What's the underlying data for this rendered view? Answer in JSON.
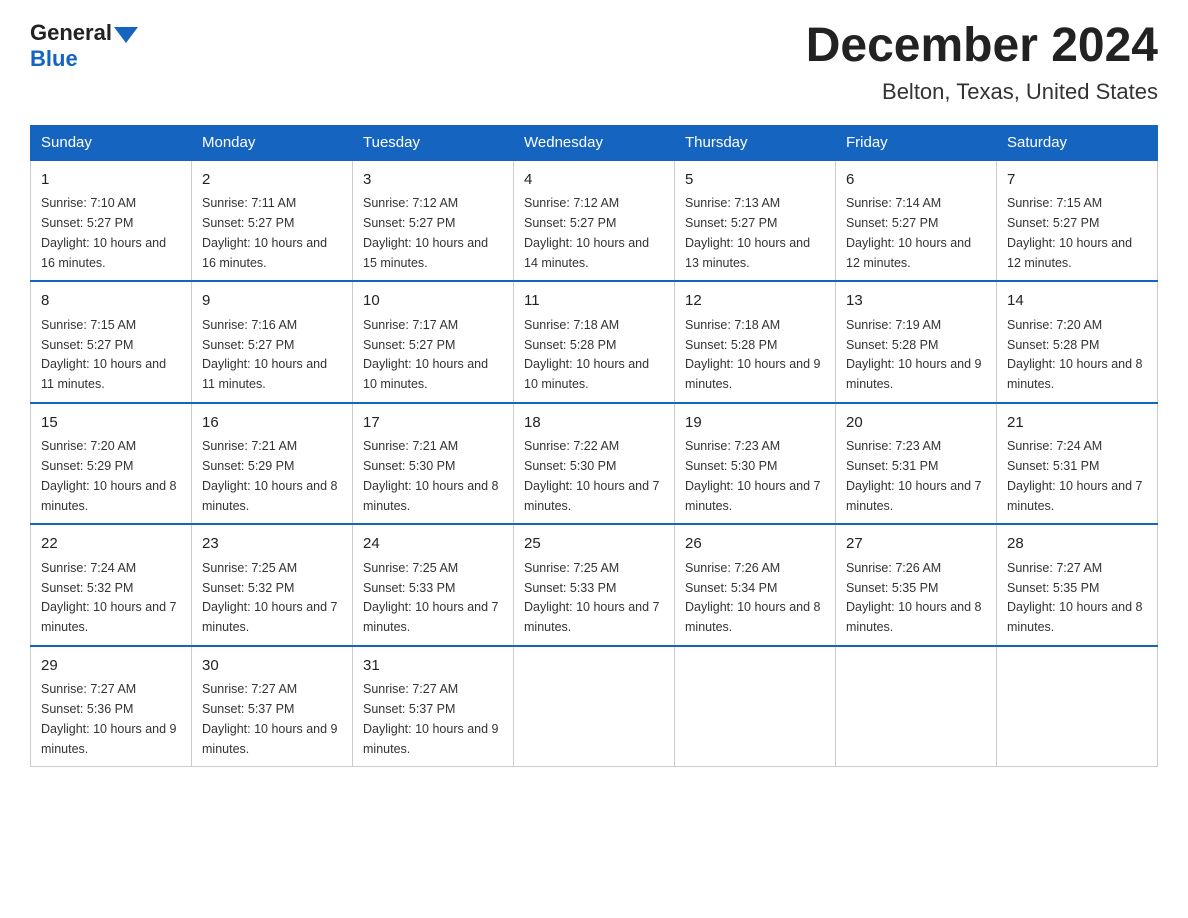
{
  "logo": {
    "general": "General",
    "triangle": "▶",
    "blue": "Blue"
  },
  "title": "December 2024",
  "subtitle": "Belton, Texas, United States",
  "days_of_week": [
    "Sunday",
    "Monday",
    "Tuesday",
    "Wednesday",
    "Thursday",
    "Friday",
    "Saturday"
  ],
  "weeks": [
    [
      {
        "day": "1",
        "sunrise": "7:10 AM",
        "sunset": "5:27 PM",
        "daylight": "10 hours and 16 minutes."
      },
      {
        "day": "2",
        "sunrise": "7:11 AM",
        "sunset": "5:27 PM",
        "daylight": "10 hours and 16 minutes."
      },
      {
        "day": "3",
        "sunrise": "7:12 AM",
        "sunset": "5:27 PM",
        "daylight": "10 hours and 15 minutes."
      },
      {
        "day": "4",
        "sunrise": "7:12 AM",
        "sunset": "5:27 PM",
        "daylight": "10 hours and 14 minutes."
      },
      {
        "day": "5",
        "sunrise": "7:13 AM",
        "sunset": "5:27 PM",
        "daylight": "10 hours and 13 minutes."
      },
      {
        "day": "6",
        "sunrise": "7:14 AM",
        "sunset": "5:27 PM",
        "daylight": "10 hours and 12 minutes."
      },
      {
        "day": "7",
        "sunrise": "7:15 AM",
        "sunset": "5:27 PM",
        "daylight": "10 hours and 12 minutes."
      }
    ],
    [
      {
        "day": "8",
        "sunrise": "7:15 AM",
        "sunset": "5:27 PM",
        "daylight": "10 hours and 11 minutes."
      },
      {
        "day": "9",
        "sunrise": "7:16 AM",
        "sunset": "5:27 PM",
        "daylight": "10 hours and 11 minutes."
      },
      {
        "day": "10",
        "sunrise": "7:17 AM",
        "sunset": "5:27 PM",
        "daylight": "10 hours and 10 minutes."
      },
      {
        "day": "11",
        "sunrise": "7:18 AM",
        "sunset": "5:28 PM",
        "daylight": "10 hours and 10 minutes."
      },
      {
        "day": "12",
        "sunrise": "7:18 AM",
        "sunset": "5:28 PM",
        "daylight": "10 hours and 9 minutes."
      },
      {
        "day": "13",
        "sunrise": "7:19 AM",
        "sunset": "5:28 PM",
        "daylight": "10 hours and 9 minutes."
      },
      {
        "day": "14",
        "sunrise": "7:20 AM",
        "sunset": "5:28 PM",
        "daylight": "10 hours and 8 minutes."
      }
    ],
    [
      {
        "day": "15",
        "sunrise": "7:20 AM",
        "sunset": "5:29 PM",
        "daylight": "10 hours and 8 minutes."
      },
      {
        "day": "16",
        "sunrise": "7:21 AM",
        "sunset": "5:29 PM",
        "daylight": "10 hours and 8 minutes."
      },
      {
        "day": "17",
        "sunrise": "7:21 AM",
        "sunset": "5:30 PM",
        "daylight": "10 hours and 8 minutes."
      },
      {
        "day": "18",
        "sunrise": "7:22 AM",
        "sunset": "5:30 PM",
        "daylight": "10 hours and 7 minutes."
      },
      {
        "day": "19",
        "sunrise": "7:23 AM",
        "sunset": "5:30 PM",
        "daylight": "10 hours and 7 minutes."
      },
      {
        "day": "20",
        "sunrise": "7:23 AM",
        "sunset": "5:31 PM",
        "daylight": "10 hours and 7 minutes."
      },
      {
        "day": "21",
        "sunrise": "7:24 AM",
        "sunset": "5:31 PM",
        "daylight": "10 hours and 7 minutes."
      }
    ],
    [
      {
        "day": "22",
        "sunrise": "7:24 AM",
        "sunset": "5:32 PM",
        "daylight": "10 hours and 7 minutes."
      },
      {
        "day": "23",
        "sunrise": "7:25 AM",
        "sunset": "5:32 PM",
        "daylight": "10 hours and 7 minutes."
      },
      {
        "day": "24",
        "sunrise": "7:25 AM",
        "sunset": "5:33 PM",
        "daylight": "10 hours and 7 minutes."
      },
      {
        "day": "25",
        "sunrise": "7:25 AM",
        "sunset": "5:33 PM",
        "daylight": "10 hours and 7 minutes."
      },
      {
        "day": "26",
        "sunrise": "7:26 AM",
        "sunset": "5:34 PM",
        "daylight": "10 hours and 8 minutes."
      },
      {
        "day": "27",
        "sunrise": "7:26 AM",
        "sunset": "5:35 PM",
        "daylight": "10 hours and 8 minutes."
      },
      {
        "day": "28",
        "sunrise": "7:27 AM",
        "sunset": "5:35 PM",
        "daylight": "10 hours and 8 minutes."
      }
    ],
    [
      {
        "day": "29",
        "sunrise": "7:27 AM",
        "sunset": "5:36 PM",
        "daylight": "10 hours and 9 minutes."
      },
      {
        "day": "30",
        "sunrise": "7:27 AM",
        "sunset": "5:37 PM",
        "daylight": "10 hours and 9 minutes."
      },
      {
        "day": "31",
        "sunrise": "7:27 AM",
        "sunset": "5:37 PM",
        "daylight": "10 hours and 9 minutes."
      },
      null,
      null,
      null,
      null
    ]
  ]
}
